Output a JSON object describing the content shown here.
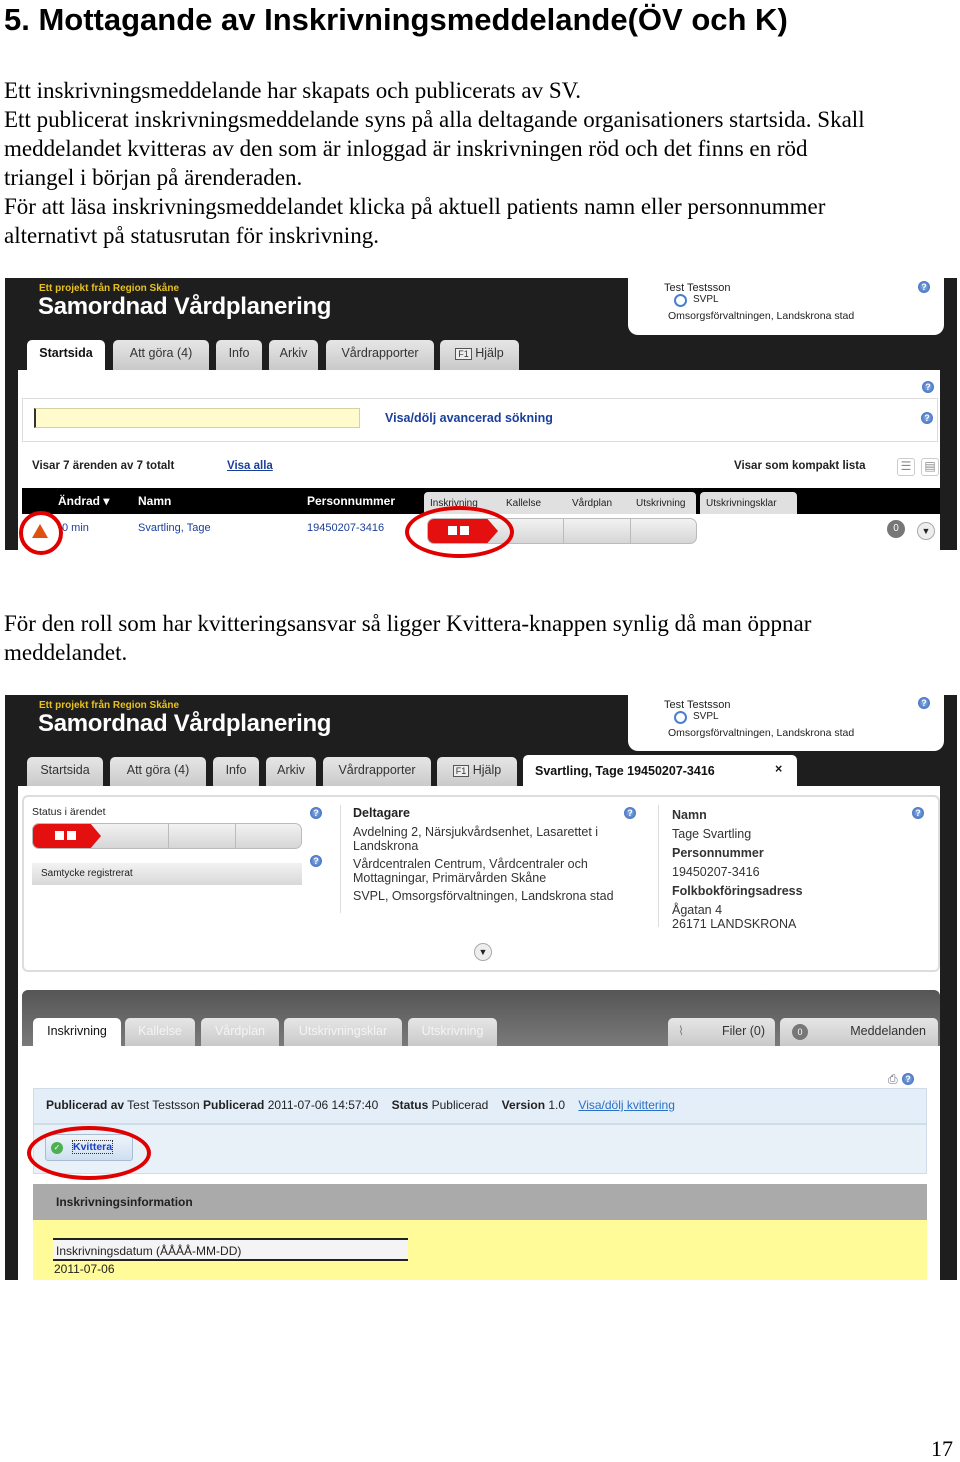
{
  "heading": "5. Mottagande av Inskrivningsmeddelande(ÖV och K)",
  "paragraph1": [
    "Ett inskrivningsmeddelande har skapats och publicerats av SV.",
    "Ett publicerat inskrivningsmeddelande syns på alla deltagande organisationers startsida. Skall",
    "meddelandet kvitteras av den som är inloggad är inskrivningen röd och det finns en röd",
    "triangel i början på ärenderaden.",
    "För att läsa inskrivningsmeddelandet klicka på aktuell patients namn eller personnummer",
    "alternativt på statusrutan för inskrivning."
  ],
  "paragraph2": [
    "För den roll som har kvitteringsansvar så ligger Kvittera-knappen synlig då man öppnar",
    "meddelandet."
  ],
  "page_number": "17",
  "app": {
    "project": "Ett projekt från Region Skåne",
    "title": "Samordnad Vårdplanering",
    "user": "Test Testsson",
    "role": "SVPL",
    "org": "Omsorgsförvaltningen, Landskrona stad",
    "tabs": [
      "Startsida",
      "Att göra (4)",
      "Info",
      "Arkiv",
      "Vårdrapporter",
      "Hjälp"
    ],
    "help_key": "F1"
  },
  "shot1": {
    "search_value": "",
    "advanced_search": "Visa/dölj avancerad sökning",
    "showing": "Visar 7 ärenden av 7 totalt",
    "show_all": "Visa alla",
    "view_mode": "Visar som kompakt lista",
    "columns": [
      "Ändrad ▾",
      "Namn",
      "Personnummer"
    ],
    "status_tabs": [
      "Inskrivning",
      "Kallelse",
      "Vårdplan",
      "Utskrivning",
      "Utskrivningsklar"
    ],
    "row": {
      "changed": "0 min",
      "name": "Svartling, Tage",
      "pnr": "19450207-3416",
      "messages": "0"
    }
  },
  "shot2": {
    "patient_tab": "Svartling, Tage 19450207-3416",
    "close": "×",
    "status_label": "Status i ärendet",
    "consent": "Samtycke registrerat",
    "participants_label": "Deltagare",
    "participants": [
      "Avdelning 2, Närsjukvårdsenhet, Lasarettet i Landskrona",
      "Vårdcentralen Centrum, Vårdcentraler och Mottagningar, Primärvården Skåne",
      "SVPL, Omsorgsförvaltningen, Landskrona stad"
    ],
    "name_label": "Namn",
    "name": "Tage Svartling",
    "pnr_label": "Personnummer",
    "pnr": "19450207-3416",
    "address_label": "Folkbokföringsadress",
    "address1": "Ågatan 4",
    "address2": "26171 LANDSKRONA",
    "sub_tabs": [
      "Inskrivning",
      "Kallelse",
      "Vårdplan",
      "Utskrivningsklar",
      "Utskrivning"
    ],
    "files": "Filer (0)",
    "messages": "Meddelanden",
    "msg_count": "0",
    "published_by_label": "Publicerad av",
    "published_by": "Test Testsson",
    "published_label": "Publicerad",
    "published": "2011-07-06 14:57:40",
    "status_label2": "Status",
    "status": "Publicerad",
    "version_label": "Version",
    "version": "1.0",
    "toggle_receipt": "Visa/dölj kvittering",
    "kvittera": "Kvittera",
    "section": "Inskrivningsinformation",
    "date_label": "Inskrivningsdatum (ÅÅÅÅ-MM-DD)",
    "date": "2011-07-06"
  },
  "colors": {
    "header_bg": "#1e1e1e",
    "status_red": "#e41010",
    "annotation_red": "#e00000",
    "highlight_yellow": "#fffb99",
    "link": "#1a3f9a"
  }
}
